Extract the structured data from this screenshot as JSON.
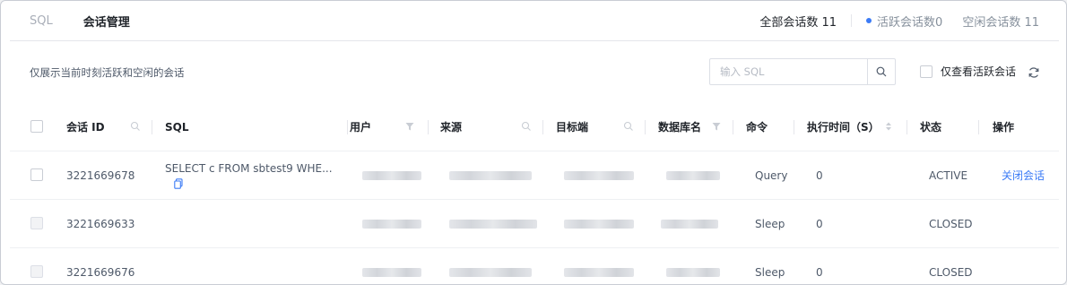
{
  "tabs": [
    {
      "label": "SQL",
      "active": false
    },
    {
      "label": "会话管理",
      "active": true
    }
  ],
  "stats": {
    "total": "全部会话数 11",
    "active": "活跃会话数0",
    "idle": "空闲会话数 11",
    "active_dot_color": "#3b7bf6"
  },
  "toolbar": {
    "hint": "仅展示当前时刻活跃和空闲的会话",
    "search_placeholder": "输入 SQL",
    "only_active_label": "仅查看活跃会话"
  },
  "table": {
    "headers": {
      "session_id": "会话 ID",
      "sql": "SQL",
      "user": "用户",
      "source": "来源",
      "target": "目标端",
      "database": "数据库名",
      "command": "命令",
      "exec_time": "执行时间（S）",
      "status": "状态",
      "actions": "操作"
    },
    "rows": [
      {
        "session_id": "3221669678",
        "sql": "SELECT c FROM sbtest9 WHE...",
        "command": "Query",
        "exec_time": "0",
        "status": "ACTIVE",
        "action": "关闭会话"
      },
      {
        "session_id": "3221669633",
        "sql": "",
        "command": "Sleep",
        "exec_time": "0",
        "status": "CLOSED",
        "action": ""
      },
      {
        "session_id": "3221669676",
        "sql": "",
        "command": "Sleep",
        "exec_time": "0",
        "status": "CLOSED",
        "action": ""
      }
    ]
  },
  "colors": {
    "accent": "#3b7bf6",
    "border": "#e5e6eb"
  }
}
